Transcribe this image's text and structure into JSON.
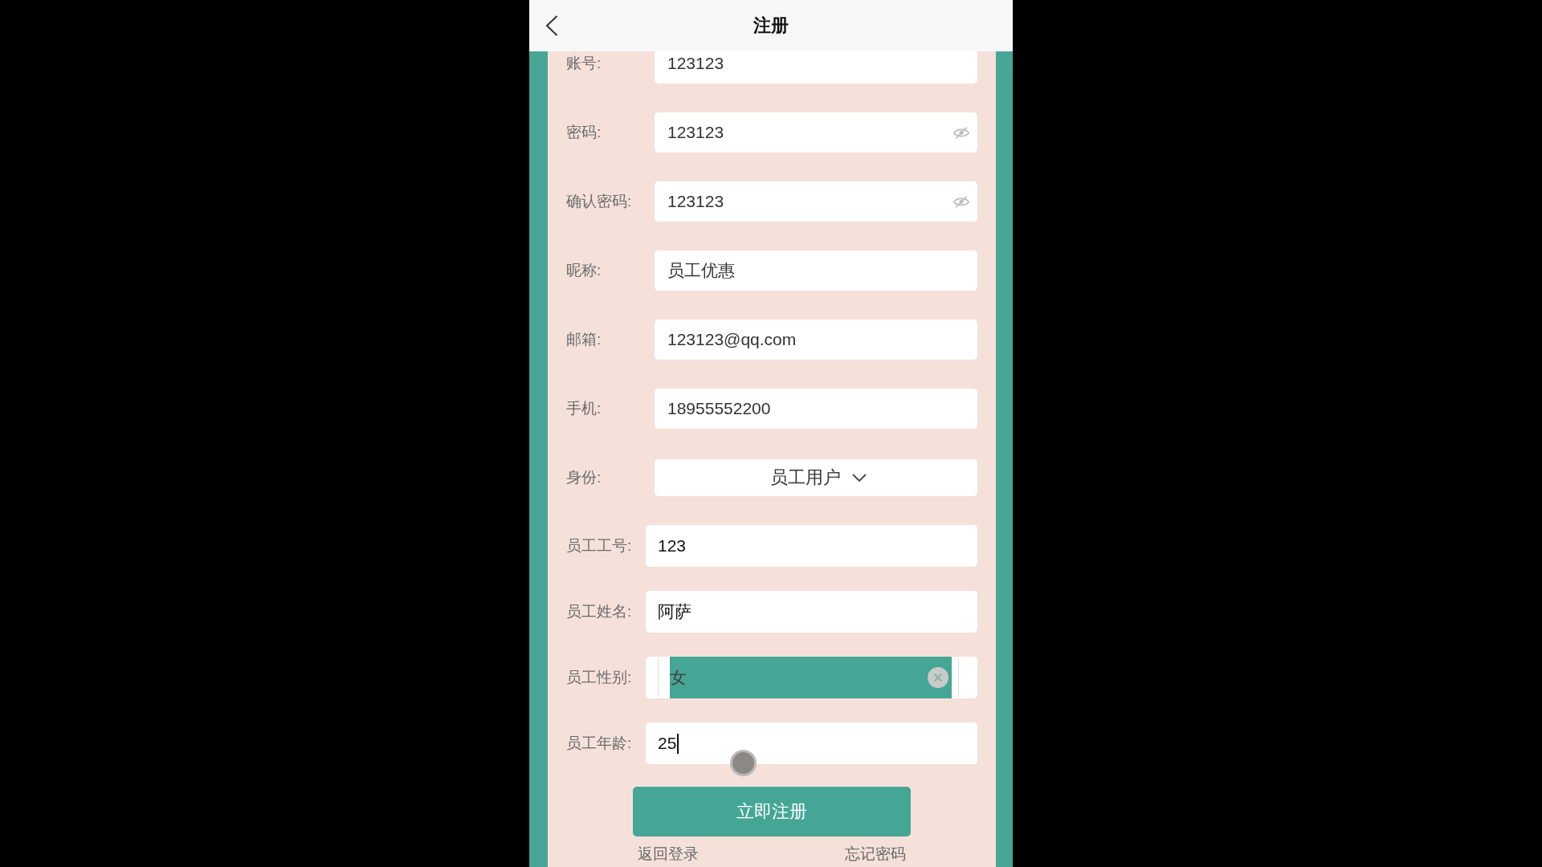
{
  "header": {
    "title": "注册"
  },
  "account_fields": [
    {
      "kind": "text",
      "label": "账号:",
      "value": "123123",
      "focused": false
    },
    {
      "kind": "password",
      "label": "密码:",
      "value": "123123",
      "focused": false
    },
    {
      "kind": "password",
      "label": "确认密码:",
      "value": "123123",
      "focused": false
    },
    {
      "kind": "text",
      "label": "昵称:",
      "value": "员工优惠",
      "focused": false
    },
    {
      "kind": "text",
      "label": "邮箱:",
      "value": "123123@qq.com",
      "focused": false
    },
    {
      "kind": "text",
      "label": "手机:",
      "value": "18955552200",
      "focused": false
    },
    {
      "kind": "select",
      "label": "身份:",
      "value": "员工用户",
      "focused": false
    }
  ],
  "employee_fields": [
    {
      "kind": "text",
      "label": "员工工号:",
      "value": "123",
      "focused": false
    },
    {
      "kind": "text",
      "label": "员工姓名:",
      "value": "阿萨",
      "focused": false
    },
    {
      "kind": "picker",
      "label": "员工性别:",
      "value": "女",
      "focused": false
    },
    {
      "kind": "text",
      "label": "员工年龄:",
      "value": "25",
      "focused": true
    }
  ],
  "submit_button": "立即注册",
  "links": [
    "返回登录",
    "忘记密码"
  ],
  "touch_indicator": true
}
